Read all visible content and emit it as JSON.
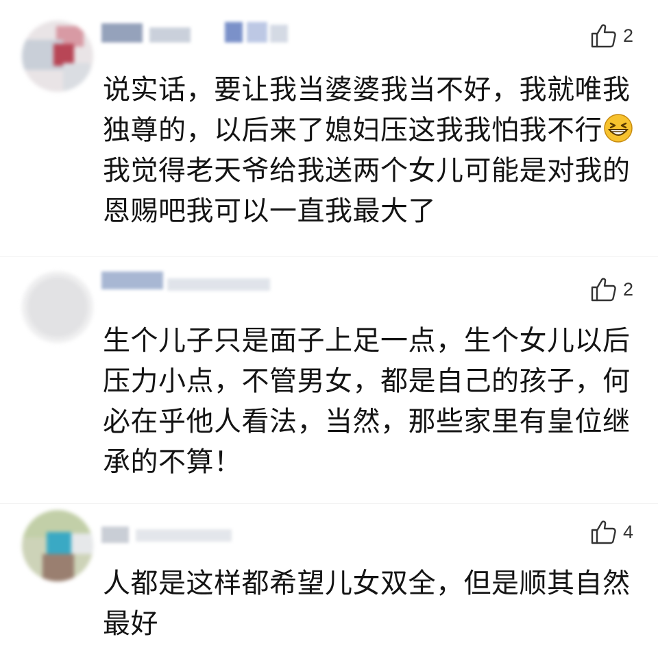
{
  "comments": [
    {
      "likes": "2",
      "text_before": "说实话，要让我当婆婆我当不好，我就唯我独尊的，以后来了媳妇压这我我怕我不行",
      "emoji": "grinning-squinting-face",
      "text_after": "我觉得老天爷给我送两个女儿可能是对我的恩赐吧我可以一直我最大了"
    },
    {
      "likes": "2",
      "text": "生个儿子只是面子上足一点，生个女儿以后压力小点，不管男女，都是自己的孩子，何必在乎他人看法，当然，那些家里有皇位继承的不算！"
    },
    {
      "likes": "4",
      "text": "人都是这样都希望儿女双全，但是顺其自然最好"
    }
  ],
  "icons": {
    "like": "thumbs-up-icon"
  },
  "colors": {
    "text": "#141414",
    "icon": "#333333",
    "background": "#ffffff"
  }
}
